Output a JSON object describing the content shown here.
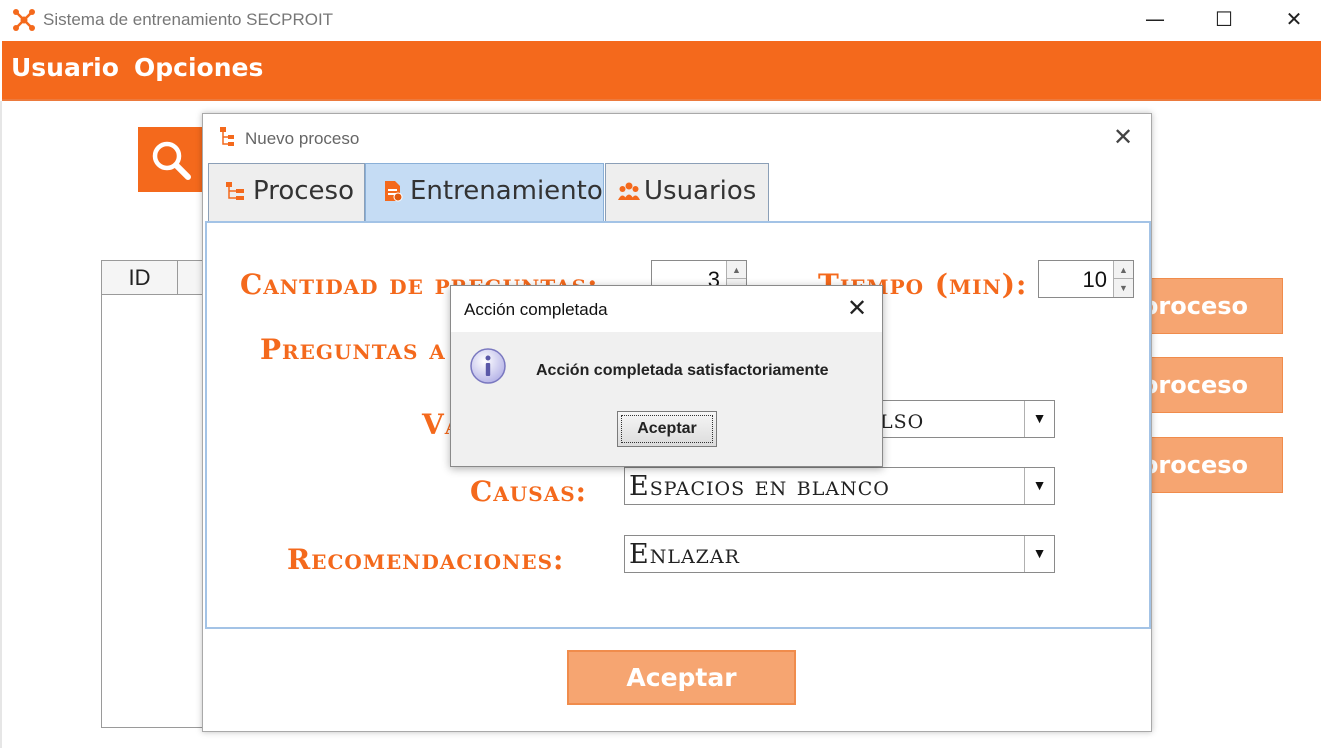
{
  "window": {
    "title": "Sistema de entrenamiento SECPROIT"
  },
  "menu": {
    "items": [
      "Usuario",
      "Opciones"
    ]
  },
  "background": {
    "table_header_id": "ID",
    "side_buttons": [
      "proceso",
      "proceso",
      "proceso"
    ]
  },
  "dialog": {
    "title": "Nuevo proceso",
    "tabs": [
      "Proceso",
      "Entrenamiento",
      "Usuarios"
    ],
    "active_tab": "Entrenamiento",
    "cantidad_label": "Cantidad de preguntas:",
    "cantidad_value": "3",
    "tiempo_label": "Tiempo (min):",
    "tiempo_value": "10",
    "preguntas_label": "Preguntas a",
    "v_label": "Va",
    "v_value": "lso",
    "causas_label": "Causas:",
    "causas_value": "Espacios en blanco",
    "recomendaciones_label": "Recomendaciones:",
    "recomendaciones_value": "Enlazar",
    "accept_label": "Aceptar"
  },
  "message": {
    "title": "Acción completada",
    "text": "Acción completada satisfactoriamente",
    "ok_label": "Aceptar"
  },
  "colors": {
    "accent": "#f4691c",
    "accent_light": "#f6a571",
    "tab_active": "#c5dcf4"
  }
}
